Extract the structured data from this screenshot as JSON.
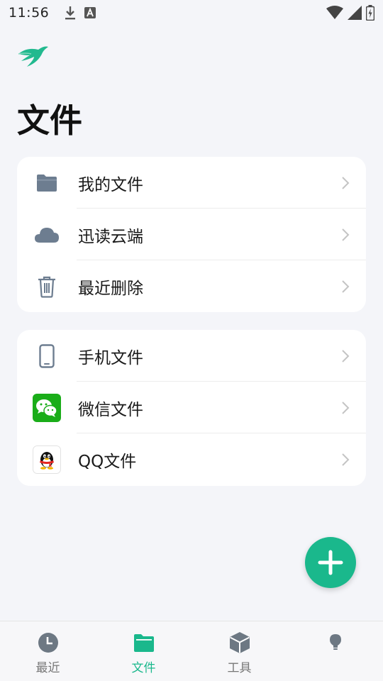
{
  "status_bar": {
    "time": "11:56",
    "icons": [
      "download-icon",
      "keyboard-a-icon",
      "wifi-icon",
      "signal-icon",
      "battery-charging-icon"
    ]
  },
  "header": {
    "logo": "swallow-logo-icon",
    "title": "文件"
  },
  "card_primary": {
    "items": [
      {
        "label": "我的文件",
        "icon": "folder-icon"
      },
      {
        "label": "迅读云端",
        "icon": "cloud-icon"
      },
      {
        "label": "最近删除",
        "icon": "trash-icon"
      }
    ]
  },
  "card_sources": {
    "items": [
      {
        "label": "手机文件",
        "icon": "phone-icon"
      },
      {
        "label": "微信文件",
        "icon": "wechat-icon"
      },
      {
        "label": "QQ文件",
        "icon": "qq-icon"
      }
    ]
  },
  "fab": {
    "icon": "plus-icon"
  },
  "bottom_nav": {
    "items": [
      {
        "label": "最近",
        "icon": "clock-icon",
        "active": false
      },
      {
        "label": "文件",
        "icon": "folder-icon",
        "active": true
      },
      {
        "label": "工具",
        "icon": "cube-icon",
        "active": false
      },
      {
        "label": "",
        "icon": "lightbulb-icon",
        "active": false
      }
    ]
  },
  "colors": {
    "accent": "#1ab88c",
    "background": "#f4f5f9",
    "icon_gray": "#6f7f92",
    "wechat_green": "#1aad19"
  }
}
